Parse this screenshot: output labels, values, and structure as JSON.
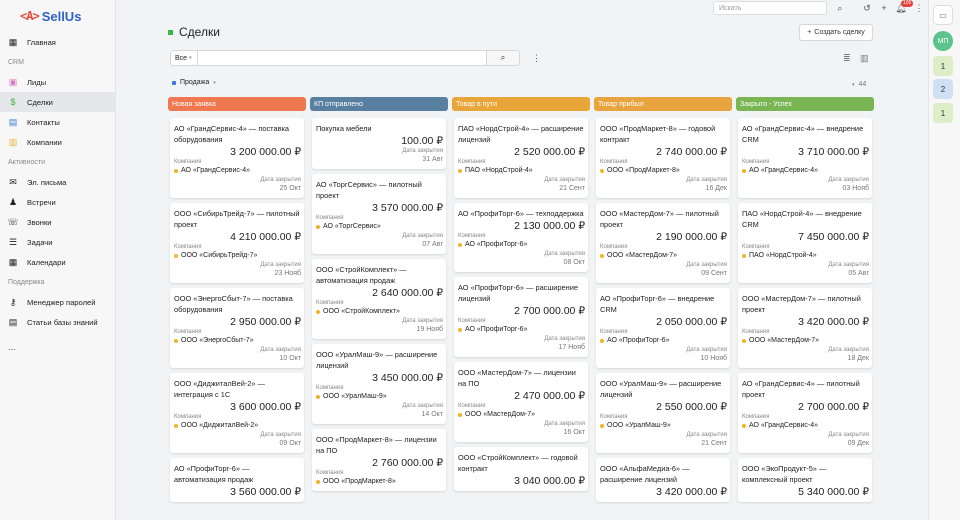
{
  "app": {
    "logo_mark": "<A>",
    "logo_text": "SellUs"
  },
  "sidebar": {
    "main": [
      {
        "label": "Главная",
        "icon": "dashboard-icon"
      }
    ],
    "crm_section": "CRM",
    "crm": [
      {
        "label": "Лиды",
        "icon": "leads-icon"
      },
      {
        "label": "Сделки",
        "icon": "dollar-icon",
        "active": true
      },
      {
        "label": "Контакты",
        "icon": "contacts-icon"
      },
      {
        "label": "Компании",
        "icon": "companies-icon"
      }
    ],
    "activities_section": "Активности",
    "activities": [
      {
        "label": "Эл. письма",
        "icon": "mail-icon"
      },
      {
        "label": "Встречи",
        "icon": "meetings-icon"
      },
      {
        "label": "Звонки",
        "icon": "phone-icon"
      },
      {
        "label": "Задачи",
        "icon": "tasks-icon"
      },
      {
        "label": "Календари",
        "icon": "calendar-icon"
      }
    ],
    "support_section": "Поддержка",
    "support": [
      {
        "label": "Менеджер паролей",
        "icon": "key-icon"
      },
      {
        "label": "Статьи базы знаний",
        "icon": "book-icon"
      }
    ],
    "more": "..."
  },
  "header": {
    "search_placeholder": "Искать",
    "notification_count": "105"
  },
  "page": {
    "title": "Сделки",
    "create_button": "Создать сделку",
    "filter_value": "Все",
    "pipeline": "Продажа",
    "total": "44"
  },
  "colors": {
    "new": "#f07850",
    "kp": "#587ea0",
    "transit": "#e8a63a",
    "arrived": "#e9a33f",
    "closed": "#79b653"
  },
  "company_label": "Компания",
  "close_date_label": "Дата закрытия",
  "columns": [
    {
      "title": "Новая заявка",
      "color": "#f07850",
      "cards": [
        {
          "title": "АО «ГрандСервис-4» — поставка оборудования",
          "amount": "3 200 000.00 ₽",
          "company": "АО «ГрандСервис-4»",
          "date": "25 Окт"
        },
        {
          "title": "ООО «СибирьТрейд-7» — пилотный проект",
          "amount": "4 210 000.00 ₽",
          "company": "ООО «СибирьТрейд-7»",
          "date": "23 Нояб"
        },
        {
          "title": "ООО «ЭнергоСбыт-7» — поставка оборудования",
          "amount": "2 950 000.00 ₽",
          "company": "ООО «ЭнергоСбыт-7»",
          "date": "10 Окт"
        },
        {
          "title": "ООО «ДиджиталВей-2» — интеграция с 1С",
          "amount": "3 600 000.00 ₽",
          "company": "ООО «ДиджиталВей-2»",
          "date": "09 Окт"
        },
        {
          "title": "АО «ПрофиТорг-6» — автоматизация продаж",
          "amount": "3 560 000.00 ₽",
          "company": "",
          "date": ""
        }
      ]
    },
    {
      "title": "КП отправлено",
      "color": "#587ea0",
      "cards": [
        {
          "title": "Покупка мебели",
          "amount": "100.00 ₽",
          "company": "",
          "date": "31 Авг"
        },
        {
          "title": "АО «ТоргСервис» — пилотный проект",
          "amount": "3 570 000.00 ₽",
          "company": "АО «ТоргСервис»",
          "date": "07 Авг"
        },
        {
          "title": "ООО «СтройКомплект» — автоматизация продаж",
          "amount": "2 640 000.00 ₽",
          "company": "ООО «СтройКомплект»",
          "date": "19 Нояб"
        },
        {
          "title": "ООО «УралМаш-9» — расширение лицензий",
          "amount": "3 450 000.00 ₽",
          "company": "ООО «УралМаш-9»",
          "date": "14 Окт"
        },
        {
          "title": "ООО «ПродМаркет-8» — лицензии на ПО",
          "amount": "2 760 000.00 ₽",
          "company": "ООО «ПродМаркет-8»",
          "date": ""
        }
      ]
    },
    {
      "title": "Товар в пути",
      "color": "#e8a63a",
      "cards": [
        {
          "title": "ПАО «НордСтрой-4» — расширение лицензий",
          "amount": "2 520 000.00 ₽",
          "company": "ПАО «НордСтрой-4»",
          "date": "21 Сент"
        },
        {
          "title": "АО «ПрофиТорг-6» — техподдержка",
          "amount": "2 130 000.00 ₽",
          "company": "АО «ПрофиТорг-6»",
          "date": "08 Окт"
        },
        {
          "title": "АО «ПрофиТорг-6» — расширение лицензий",
          "amount": "2 700 000.00 ₽",
          "company": "АО «ПрофиТорг-6»",
          "date": "17 Нояб"
        },
        {
          "title": "ООО «МастерДом-7» — лицензии на ПО",
          "amount": "2 470 000.00 ₽",
          "company": "ООО «МастерДом-7»",
          "date": "16 Окт"
        },
        {
          "title": "ООО «СтройКомплект» — годовой контракт",
          "amount": "3 040 000.00 ₽",
          "company": "",
          "date": ""
        }
      ]
    },
    {
      "title": "Товар прибыл",
      "color": "#e9a33f",
      "cards": [
        {
          "title": "ООО «ПродМаркет-8» — годовой контракт",
          "amount": "2 740 000.00 ₽",
          "company": "ООО «ПродМаркет-8»",
          "date": "16 Дек"
        },
        {
          "title": "ООО «МастерДом-7» — пилотный проект",
          "amount": "2 190 000.00 ₽",
          "company": "ООО «МастерДом-7»",
          "date": "09 Сент"
        },
        {
          "title": "АО «ПрофиТорг-6» — внедрение CRM",
          "amount": "2 050 000.00 ₽",
          "company": "АО «ПрофиТорг-6»",
          "date": "10 Нояб"
        },
        {
          "title": "ООО «УралМаш-9» — расширение лицензий",
          "amount": "2 550 000.00 ₽",
          "company": "ООО «УралМаш-9»",
          "date": "21 Сент"
        },
        {
          "title": "ООО «АльфаМедиа-6» — расширение лицензий",
          "amount": "3 420 000.00 ₽",
          "company": "",
          "date": ""
        }
      ]
    },
    {
      "title": "Закрыто - Успех",
      "color": "#79b653",
      "cards": [
        {
          "title": "АО «ГрандСервис-4» — внедрение CRM",
          "amount": "3 710 000.00 ₽",
          "company": "АО «ГрандСервис-4»",
          "date": "03 Нояб"
        },
        {
          "title": "ПАО «НордСтрой-4» — внедрение CRM",
          "amount": "7 450 000.00 ₽",
          "company": "ПАО «НордСтрой-4»",
          "date": "05 Авг"
        },
        {
          "title": "ООО «МастерДом-7» — пилотный проект",
          "amount": "3 420 000.00 ₽",
          "company": "ООО «МастерДом-7»",
          "date": "18 Дек"
        },
        {
          "title": "АО «ГрандСервис-4» — пилотный проект",
          "amount": "2 700 000.00 ₽",
          "company": "АО «ГрандСервис-4»",
          "date": "09 Дек"
        },
        {
          "title": "ООО «ЭкоПродукт-5» — комплексный проект",
          "amount": "5 340 000.00 ₽",
          "company": "",
          "date": ""
        }
      ]
    }
  ],
  "rail": {
    "avatar": "МП",
    "counters": [
      "1",
      "2",
      "1"
    ]
  }
}
